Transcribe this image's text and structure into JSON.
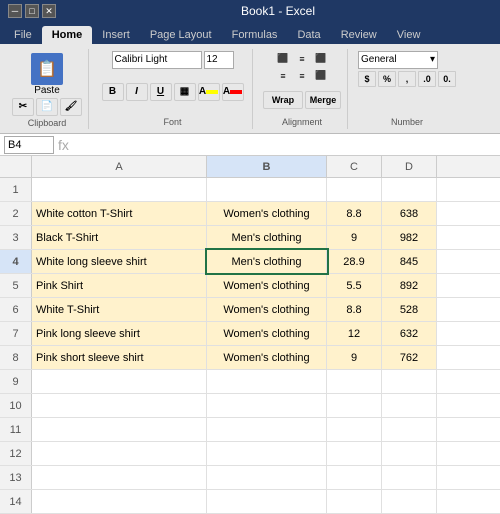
{
  "window": {
    "title": "Book1 - Excel"
  },
  "ribbon_tabs": [
    "File",
    "Home",
    "Insert",
    "Page Layout",
    "Formulas",
    "Data",
    "Review",
    "View"
  ],
  "active_tab": "Home",
  "font": {
    "name": "Calibri Light",
    "size": "12"
  },
  "name_box": {
    "value": "B4"
  },
  "formula_bar": {
    "content": ""
  },
  "columns": [
    "",
    "A",
    "B",
    "C",
    "D"
  ],
  "rows": [
    {
      "num": "1",
      "a": "",
      "b": "",
      "c": "",
      "d": "",
      "filled": false
    },
    {
      "num": "2",
      "a": "White cotton T-Shirt",
      "b": "Women's clothing",
      "c": "8.8",
      "d": "638",
      "filled": true
    },
    {
      "num": "3",
      "a": "Black T-Shirt",
      "b": "Men's clothing",
      "c": "9",
      "d": "982",
      "filled": true
    },
    {
      "num": "4",
      "a": "White long sleeve shirt",
      "b": "Men's clothing",
      "c": "28.9",
      "d": "845",
      "filled": true,
      "selected": true
    },
    {
      "num": "5",
      "a": "Pink Shirt",
      "b": "Women's clothing",
      "c": "5.5",
      "d": "892",
      "filled": true
    },
    {
      "num": "6",
      "a": "White T-Shirt",
      "b": "Women's clothing",
      "c": "8.8",
      "d": "528",
      "filled": true
    },
    {
      "num": "7",
      "a": "Pink long sleeve shirt",
      "b": "Women's clothing",
      "c": "12",
      "d": "632",
      "filled": true
    },
    {
      "num": "8",
      "a": "Pink short sleeve shirt",
      "b": "Women's clothing",
      "c": "9",
      "d": "762",
      "filled": true
    },
    {
      "num": "9",
      "a": "",
      "b": "",
      "c": "",
      "d": "",
      "filled": false
    },
    {
      "num": "10",
      "a": "",
      "b": "",
      "c": "",
      "d": "",
      "filled": false
    },
    {
      "num": "11",
      "a": "",
      "b": "",
      "c": "",
      "d": "",
      "filled": false
    },
    {
      "num": "12",
      "a": "",
      "b": "",
      "c": "",
      "d": "",
      "filled": false
    },
    {
      "num": "13",
      "a": "",
      "b": "",
      "c": "",
      "d": "",
      "filled": false
    },
    {
      "num": "14",
      "a": "",
      "b": "",
      "c": "",
      "d": "",
      "filled": false
    }
  ],
  "toolbar": {
    "clipboard_label": "Clipboard",
    "font_label": "Font",
    "alignment_label": "Alignment",
    "number_label": "Number",
    "paste_label": "Paste",
    "bold_label": "B",
    "italic_label": "I",
    "underline_label": "U",
    "number_format": "General"
  }
}
